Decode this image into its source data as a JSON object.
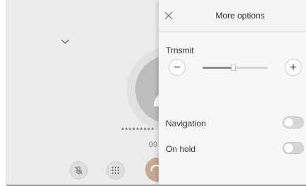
{
  "call": {
    "masked_number": "*********",
    "timer": "00"
  },
  "icons": {
    "dropdown": "chevron-down-icon",
    "avatar": "person-icon",
    "mute": "mic-off-icon",
    "keypad": "dialpad-icon",
    "end_call": "phone-hangup-icon",
    "close": "close-icon"
  },
  "options_panel": {
    "title": "More options",
    "transmit": {
      "label": "Trnsmit",
      "minus_symbol": "−",
      "plus_symbol": "+",
      "level": 0.47
    },
    "toggles": [
      {
        "label": "Navigation",
        "enabled": false
      },
      {
        "label": "On hold",
        "enabled": false
      }
    ]
  },
  "colors": {
    "end_call": "#c7a994",
    "panel_background": "#f7f7f7",
    "screen_background": "#ececec"
  }
}
